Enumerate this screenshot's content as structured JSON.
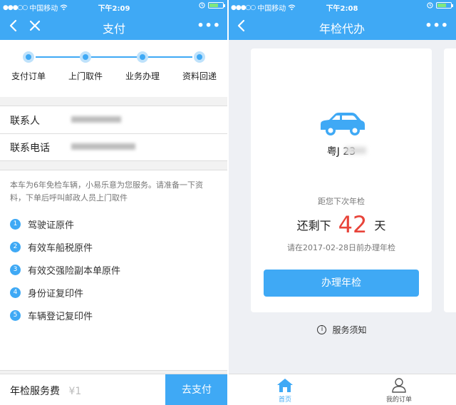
{
  "colors": {
    "accent": "#3fa9f5",
    "highlight": "#e8443a"
  },
  "left": {
    "status": {
      "carrier": "中国移动",
      "time": "下午2:09"
    },
    "nav": {
      "title": "支付",
      "back_icon": "chevron-left-icon",
      "close_icon": "close-icon",
      "more_label": "•••"
    },
    "steps": [
      "支付订单",
      "上门取件",
      "业务办理",
      "资料回递"
    ],
    "contact": {
      "name_label": "联系人",
      "phone_label": "联系电话"
    },
    "notice": {
      "intro": "本车为6年免检车辆，小易乐意为您服务。请准备一下资料，下单后呼叫邮政人员上门取件",
      "documents": [
        {
          "num": "1",
          "text": "驾驶证原件"
        },
        {
          "num": "2",
          "text": "有效车船税原件"
        },
        {
          "num": "3",
          "text": "有效交强险副本单原件"
        },
        {
          "num": "4",
          "text": "身份证复印件"
        },
        {
          "num": "5",
          "text": "车辆登记复印件"
        }
      ]
    },
    "paybar": {
      "fee_label": "年检服务费",
      "fee_value": "¥1",
      "pay_button": "去支付"
    }
  },
  "right": {
    "status": {
      "carrier": "中国移动",
      "time": "下午2:08"
    },
    "nav": {
      "title": "年检代办",
      "back_icon": "chevron-left-icon",
      "more_label": "•••"
    },
    "card": {
      "car_icon": "car-icon",
      "plate": "粤J  23",
      "next_label": "距您下次年检",
      "remain_prefix": "还剩下",
      "remain_days": "42",
      "remain_suffix": "天",
      "deadline": "请在2017-02-28日前办理年检",
      "action_button": "办理年检"
    },
    "service_notice": "服务须知",
    "tabs": [
      {
        "label": "首页",
        "icon": "home-icon",
        "active": true
      },
      {
        "label": "我的订单",
        "icon": "user-icon",
        "active": false
      }
    ]
  }
}
